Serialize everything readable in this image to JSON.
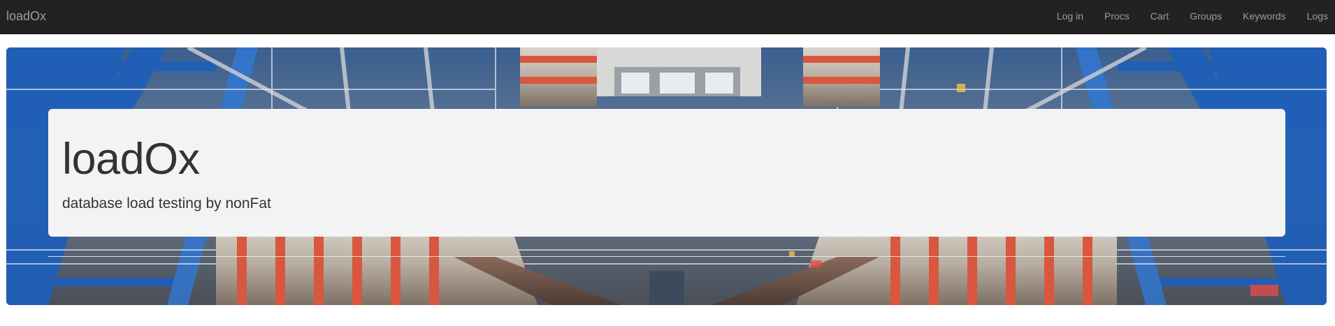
{
  "navbar": {
    "brand": "loadOx",
    "items": [
      {
        "label": "Log in"
      },
      {
        "label": "Procs"
      },
      {
        "label": "Cart"
      },
      {
        "label": "Groups"
      },
      {
        "label": "Keywords"
      },
      {
        "label": "Logs"
      }
    ]
  },
  "hero": {
    "title": "loadOx",
    "subtitle": "database load testing by nonFat",
    "background_image": "industrial particle-detector photo"
  },
  "colors": {
    "navbar_bg": "#222222",
    "navbar_text": "#9d9d9d",
    "jumbotron_bg": "#f3f3f3",
    "text": "#333333"
  }
}
